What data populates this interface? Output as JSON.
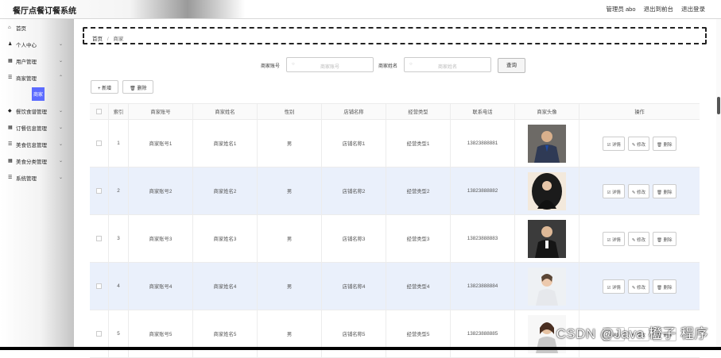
{
  "app": {
    "title": "餐厅点餐订餐系统"
  },
  "header": {
    "user_label": "管理员 abo",
    "front_link": "退出到前台",
    "logout_link": "退出登录"
  },
  "sidebar": {
    "items": [
      {
        "label": "首页",
        "icon": "home-icon",
        "glyph": "⌂"
      },
      {
        "label": "个人中心",
        "icon": "user-icon",
        "glyph": "♟"
      },
      {
        "label": "用户管理",
        "icon": "grid-icon",
        "glyph": "▦"
      },
      {
        "label": "商家管理",
        "icon": "list-icon",
        "glyph": "☰"
      },
      {
        "label": "餐饮食谱管理",
        "icon": "food-icon",
        "glyph": "◆"
      },
      {
        "label": "订餐信息管理",
        "icon": "grid-icon",
        "glyph": "▦"
      },
      {
        "label": "美食信息管理",
        "icon": "list-icon",
        "glyph": "☰"
      },
      {
        "label": "美食分类管理",
        "icon": "grid-icon",
        "glyph": "▦"
      },
      {
        "label": "系统管理",
        "icon": "list-icon",
        "glyph": "☰"
      }
    ],
    "active_sub": "商家",
    "active_color": "#5c6bff"
  },
  "breadcrumb": {
    "home": "首页",
    "separator": "/",
    "current": "商家"
  },
  "search": {
    "account_label": "商家账号",
    "account_placeholder": "商家账号",
    "name_label": "商家姓名",
    "name_placeholder": "商家姓名",
    "query_button": "查询"
  },
  "toolbar": {
    "add_label": "+ 新增",
    "delete_label": "🗑 删除"
  },
  "table": {
    "columns": [
      "索引",
      "商家账号",
      "商家姓名",
      "性别",
      "店铺名称",
      "经营类型",
      "联系电话",
      "商家头像",
      "操作"
    ],
    "actions": {
      "detail": "☑ 详情",
      "edit": "✎ 修改",
      "delete": "🗑 删除"
    },
    "rows": [
      {
        "index": "1",
        "account": "商家账号1",
        "name": "商家姓名1",
        "gender": "男",
        "shop": "店铺名称1",
        "type": "经营类型1",
        "phone": "13823888881"
      },
      {
        "index": "2",
        "account": "商家账号2",
        "name": "商家姓名2",
        "gender": "男",
        "shop": "店铺名称2",
        "type": "经营类型2",
        "phone": "13823888882"
      },
      {
        "index": "3",
        "account": "商家账号3",
        "name": "商家姓名3",
        "gender": "男",
        "shop": "店铺名称3",
        "type": "经营类型3",
        "phone": "13823888883"
      },
      {
        "index": "4",
        "account": "商家账号4",
        "name": "商家姓名4",
        "gender": "男",
        "shop": "店铺名称4",
        "type": "经营类型4",
        "phone": "13823888884"
      },
      {
        "index": "5",
        "account": "商家账号5",
        "name": "商家姓名5",
        "gender": "男",
        "shop": "店铺名称5",
        "type": "经营类型5",
        "phone": "13823888885"
      }
    ]
  },
  "watermark": "CSDN @Java  橙子  程序"
}
